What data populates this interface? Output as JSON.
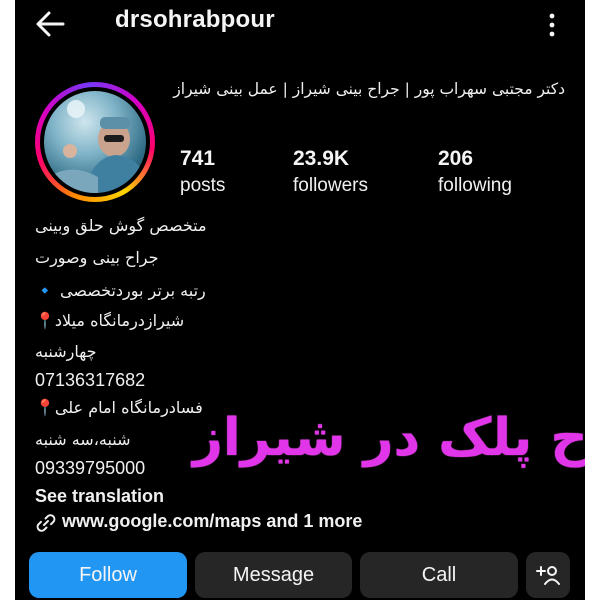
{
  "header": {
    "username": "drsohrabpour",
    "back_icon": "arrow-left-icon",
    "more_icon": "more-vertical-icon"
  },
  "profile": {
    "full_name": "دکتر مجتبی سهراب پور | جراح بینی شیراز | عمل بینی شیراز",
    "stats": [
      {
        "value": "741",
        "label": "posts"
      },
      {
        "value": "23.9K",
        "label": "followers"
      },
      {
        "value": "206",
        "label": "following"
      }
    ]
  },
  "bio": {
    "line1": "متخصص گوش حلق وبینی",
    "line2": "جراح بینی وصورت",
    "line3": "رتبه برتر بوردتخصصی 🔹",
    "line4": "شیرازدرمانگاه میلاد📍",
    "line5": "چهارشنبه",
    "line6": "07136317682",
    "line7": "فسادرمانگاه امام علی📍",
    "line8": "شنبه،سه شنبه",
    "line9": "09339795000",
    "see_translation": "See translation"
  },
  "overlay": {
    "text": "جراح پلک در شیراز",
    "color": "#e035e8"
  },
  "link": {
    "text": "www.google.com/maps and 1 more",
    "icon": "link-icon"
  },
  "actions": {
    "follow": "Follow",
    "message": "Message",
    "call": "Call",
    "suggest_icon": "add-person-icon"
  },
  "colors": {
    "background": "#000000",
    "follow_button": "#2196f3",
    "secondary_button": "#262626",
    "text": "#f5f5f5"
  }
}
